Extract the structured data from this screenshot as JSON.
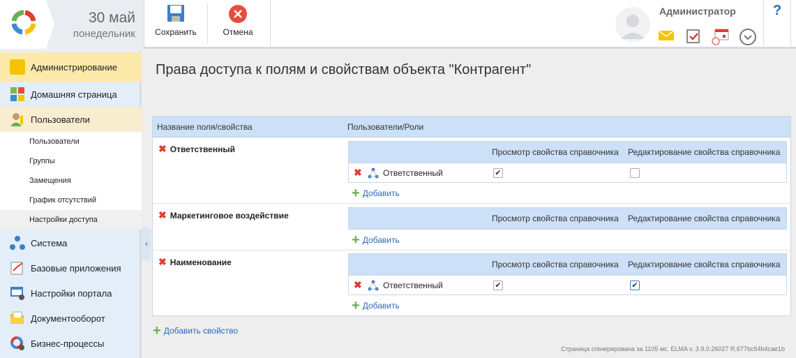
{
  "header": {
    "date": "30 май",
    "weekday": "понедельник",
    "save_label": "Сохранить",
    "cancel_label": "Отмена",
    "user_name": "Администратор",
    "help": "?"
  },
  "sidebar": {
    "items": [
      {
        "label": "Администрирование",
        "icon": "lock-key-icon"
      },
      {
        "label": "Домашняя страница",
        "icon": "home-tiles-icon"
      },
      {
        "label": "Пользователи",
        "icon": "users-icon"
      },
      {
        "label": "Система",
        "icon": "system-icon"
      },
      {
        "label": "Базовые приложения",
        "icon": "apps-icon"
      },
      {
        "label": "Настройки портала",
        "icon": "portal-settings-icon"
      },
      {
        "label": "Документооборот",
        "icon": "folder-icon"
      },
      {
        "label": "Бизнес-процессы",
        "icon": "processes-icon"
      }
    ],
    "sub_items": [
      "Пользователи",
      "Группы",
      "Замещения",
      "График отсутствий",
      "Настройки доступа"
    ]
  },
  "main": {
    "title": "Права доступа к полям и свойствам объекта \"Контрагент\"",
    "col_field": "Название поля/свойства",
    "col_users": "Пользователи/Роли",
    "col_view": "Просмотр свойства справочника",
    "col_edit": "Редактирование свойства справочника",
    "add_label": "Добавить",
    "add_property": "Добавить свойство",
    "rows": [
      {
        "name": "Ответственный",
        "entry": {
          "name": "Ответственный",
          "view": true,
          "edit": false
        }
      },
      {
        "name": "Маркетинговое воздействие"
      },
      {
        "name": "Наименование",
        "entry": {
          "name": "Ответственный",
          "view": true,
          "edit": true
        }
      }
    ]
  },
  "footer": "Страница сгенерирована за 1105 мс. ELMA v. 3.9.0.26027 R.677bc54b4cae1b"
}
